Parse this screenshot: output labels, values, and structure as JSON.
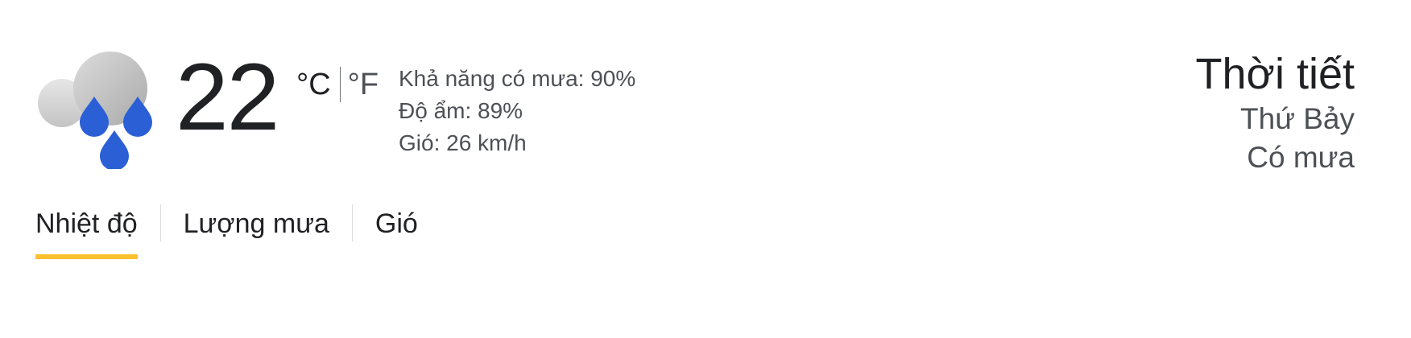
{
  "current": {
    "icon": "rain-cloud-icon",
    "temperature": "22",
    "unit_c": "°C",
    "unit_f": "°F",
    "precipitation": "Khả năng có mưa: 90%",
    "humidity": "Độ ẩm: 89%",
    "wind": "Gió: 26 km/h"
  },
  "header": {
    "title": "Thời tiết",
    "day": "Thứ Bảy",
    "condition": "Có mưa"
  },
  "tabs": [
    {
      "label": "Nhiệt độ",
      "active": true
    },
    {
      "label": "Lượng mưa",
      "active": false
    },
    {
      "label": "Gió",
      "active": false
    }
  ],
  "colors": {
    "accent": "#fbc02d",
    "rain_drop": "#2a5fd6",
    "cloud": "#c8c8c8"
  }
}
